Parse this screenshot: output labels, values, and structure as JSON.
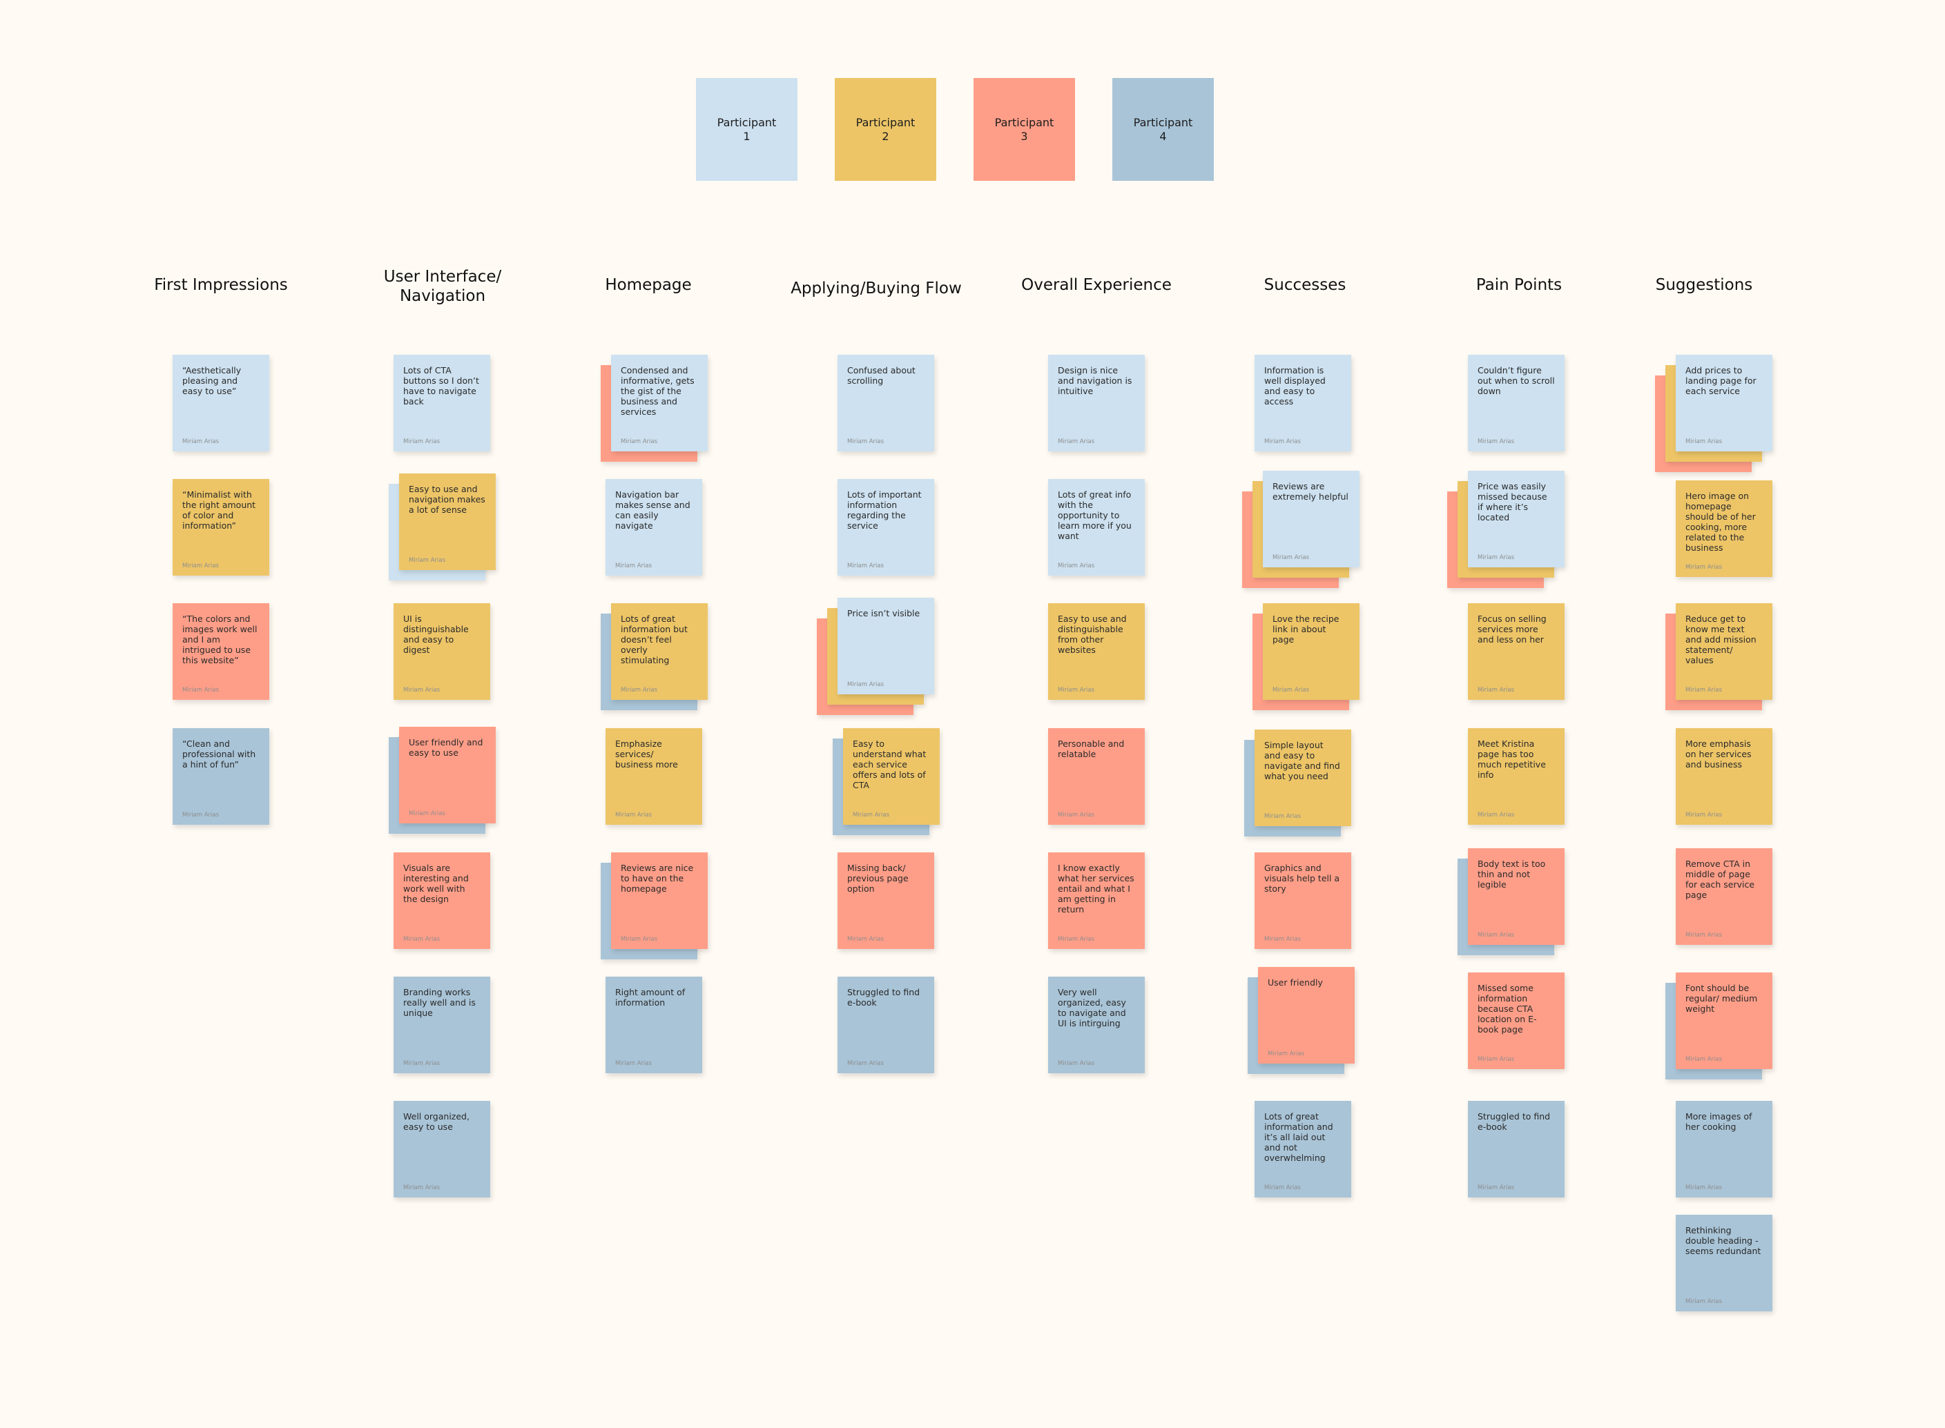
{
  "colors": {
    "p1": "#cde1f0",
    "p2": "#edc567",
    "p3": "#ff9e88",
    "p4": "#a9c4d7",
    "background": "#fffbf4"
  },
  "legend": [
    {
      "label": "Participant\n1",
      "color": "p1"
    },
    {
      "label": "Participant\n2",
      "color": "p2"
    },
    {
      "label": "Participant\n3",
      "color": "p3"
    },
    {
      "label": "Participant\n4",
      "color": "p4"
    }
  ],
  "author": "Miriam Arias",
  "columns": [
    {
      "title": "First Impressions",
      "notes": [
        {
          "text": "“Aesthetically pleasing and easy to use”",
          "color": "p1",
          "stack": []
        },
        {
          "text": "“Minimalist with the right amount of color and information”",
          "color": "p2",
          "stack": []
        },
        {
          "text": "“The colors and images work well and I am intrigued to use this website”",
          "color": "p3",
          "stack": []
        },
        {
          "text": "“Clean and professional with a hint of fun”",
          "color": "p4",
          "stack": []
        }
      ]
    },
    {
      "title": "User Interface/\nNavigation",
      "notes": [
        {
          "text": "Lots of CTA buttons so I don’t have to navigate back",
          "color": "p1",
          "stack": []
        },
        {
          "text": "Easy to use and navigation makes a lot of sense",
          "color": "p2",
          "stack": [
            "p1"
          ]
        },
        {
          "text": "UI is distinguishable and easy to digest",
          "color": "p2",
          "stack": []
        },
        {
          "text": "User friendly and easy to use",
          "color": "p3",
          "stack": [
            "p4"
          ]
        },
        {
          "text": "Visuals are interesting and work well with the design",
          "color": "p3",
          "stack": []
        },
        {
          "text": "Branding works really well and is unique",
          "color": "p4",
          "stack": []
        },
        {
          "text": "Well organized, easy to use",
          "color": "p4",
          "stack": []
        }
      ]
    },
    {
      "title": "Homepage",
      "notes": [
        {
          "text": "Condensed and informative, gets the gist of the business and services",
          "color": "p1",
          "stack": [
            "p3"
          ]
        },
        {
          "text": "Navigation bar makes sense and can easily navigate",
          "color": "p1",
          "stack": []
        },
        {
          "text": "Lots of great information but doesn’t feel overly stimulating",
          "color": "p2",
          "stack": [
            "p4"
          ]
        },
        {
          "text": "Emphasize services/ business more",
          "color": "p2",
          "stack": []
        },
        {
          "text": "Reviews are nice to have on the homepage",
          "color": "p3",
          "stack": [
            "p4"
          ]
        },
        {
          "text": "Right amount of information",
          "color": "p4",
          "stack": []
        }
      ]
    },
    {
      "title": "Applying/Buying Flow",
      "notes": [
        {
          "text": "Confused about scrolling",
          "color": "p1",
          "stack": []
        },
        {
          "text": "Lots of important information regarding the service",
          "color": "p1",
          "stack": []
        },
        {
          "text": "Price isn’t visible",
          "color": "p1",
          "stack": [
            "p3",
            "p2"
          ]
        },
        {
          "text": "Easy to understand what each service offers and lots of CTA",
          "color": "p2",
          "stack": [
            "p4"
          ]
        },
        {
          "text": "Missing back/ previous page option",
          "color": "p3",
          "stack": []
        },
        {
          "text": "Struggled to find e-book",
          "color": "p4",
          "stack": []
        }
      ]
    },
    {
      "title": "Overall Experience",
      "notes": [
        {
          "text": "Design is nice and navigation is intuitive",
          "color": "p1",
          "stack": []
        },
        {
          "text": "Lots of great info with the opportunity to learn more if you want",
          "color": "p1",
          "stack": []
        },
        {
          "text": "Easy to use and distinguishable from other websites",
          "color": "p2",
          "stack": []
        },
        {
          "text": "Personable and relatable",
          "color": "p3",
          "stack": []
        },
        {
          "text": "I know exactly what her services entail and what I am getting in return",
          "color": "p3",
          "stack": []
        },
        {
          "text": "Very well organized, easy to navigate and UI is intirguing",
          "color": "p4",
          "stack": []
        }
      ]
    },
    {
      "title": "Successes",
      "notes": [
        {
          "text": "Information is well displayed and easy to access",
          "color": "p1",
          "stack": []
        },
        {
          "text": "Reviews are extremely helpful",
          "color": "p1",
          "stack": [
            "p3",
            "p2"
          ]
        },
        {
          "text": "Love the recipe link in about page",
          "color": "p2",
          "stack": [
            "p3"
          ]
        },
        {
          "text": "Simple layout and easy to navigate and find what you need",
          "color": "p2",
          "stack": [
            "p4"
          ]
        },
        {
          "text": "Graphics and visuals help tell a story",
          "color": "p3",
          "stack": []
        },
        {
          "text": "User friendly",
          "color": "p3",
          "stack": [
            "p4"
          ]
        },
        {
          "text": "Lots of great information and it’s all laid out and not overwhelming",
          "color": "p4",
          "stack": []
        }
      ]
    },
    {
      "title": "Pain Points",
      "notes": [
        {
          "text": "Couldn’t figure out when to scroll down",
          "color": "p1",
          "stack": []
        },
        {
          "text": "Price was easily missed because if where it’s located",
          "color": "p1",
          "stack": [
            "p3",
            "p2"
          ]
        },
        {
          "text": "Focus on selling services more and less on her",
          "color": "p2",
          "stack": []
        },
        {
          "text": "Meet Kristina page has too much repetitive info",
          "color": "p2",
          "stack": []
        },
        {
          "text": "Body text is too thin and not legible",
          "color": "p3",
          "stack": [
            "p4"
          ]
        },
        {
          "text": "Missed some information because CTA location on E-book page",
          "color": "p3",
          "stack": []
        },
        {
          "text": "Struggled to find e-book",
          "color": "p4",
          "stack": []
        }
      ]
    },
    {
      "title": "Suggestions",
      "notes": [
        {
          "text": "Add prices to landing page for each service",
          "color": "p1",
          "stack": [
            "p3",
            "p2"
          ]
        },
        {
          "text": "Hero image on homepage should be of her cooking, more related to the business",
          "color": "p2",
          "stack": []
        },
        {
          "text": "Reduce get to know me text and add mission statement/ values",
          "color": "p2",
          "stack": [
            "p3"
          ]
        },
        {
          "text": "More emphasis on her services and business",
          "color": "p2",
          "stack": []
        },
        {
          "text": "Remove CTA in middle of page for each service page",
          "color": "p3",
          "stack": []
        },
        {
          "text": "Font should be regular/ medium weight",
          "color": "p3",
          "stack": [
            "p4"
          ]
        },
        {
          "text": "More images of her cooking",
          "color": "p4",
          "stack": []
        },
        {
          "text": "Rethinking double heading - seems redundant",
          "color": "p4",
          "stack": []
        }
      ]
    }
  ]
}
